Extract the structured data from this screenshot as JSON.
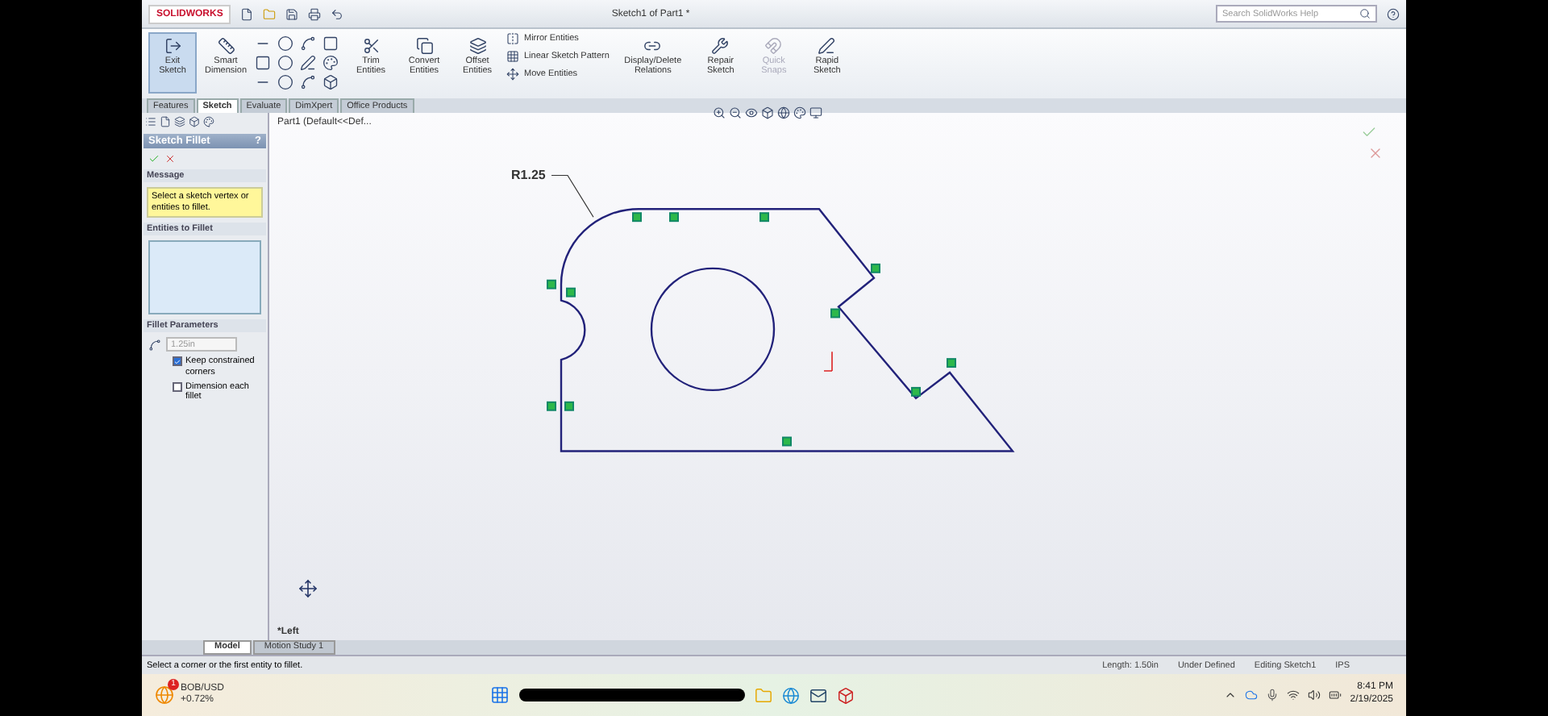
{
  "title_bar": {
    "logo": "SOLIDWORKS",
    "title": "Sketch1 of Part1 *",
    "search": {
      "placeholder": "Search SolidWorks Help"
    }
  },
  "ribbon": {
    "items": [
      {
        "kind": "button",
        "label": "Exit Sketch",
        "selected": true,
        "disabled": false
      },
      {
        "kind": "button",
        "label": "Smart Dimension",
        "selected": false,
        "disabled": false
      },
      {
        "kind": "tools"
      },
      {
        "kind": "button",
        "label": "Trim Entities",
        "selected": false,
        "disabled": false
      },
      {
        "kind": "button",
        "label": "Convert Entities",
        "selected": false,
        "disabled": false
      },
      {
        "kind": "button",
        "label": "Offset Entities",
        "selected": false,
        "disabled": false
      },
      {
        "kind": "list",
        "entries": [
          "Mirror Entities",
          "Linear Sketch Pattern",
          "Move Entities"
        ]
      },
      {
        "kind": "button",
        "label": "Display/Delete Relations",
        "selected": false,
        "disabled": false
      },
      {
        "kind": "button",
        "label": "Repair Sketch",
        "selected": false,
        "disabled": false
      },
      {
        "kind": "button",
        "label": "Quick Snaps",
        "selected": false,
        "disabled": true
      },
      {
        "kind": "button",
        "label": "Rapid Sketch",
        "selected": false,
        "disabled": false
      }
    ]
  },
  "command_tabs": [
    {
      "label": "Features",
      "selected": false
    },
    {
      "label": "Sketch",
      "selected": true
    },
    {
      "label": "Evaluate",
      "selected": false
    },
    {
      "label": "DimXpert",
      "selected": false
    },
    {
      "label": "Office Products",
      "selected": false
    }
  ],
  "property_manager": {
    "title": "Sketch Fillet",
    "help": "?",
    "message": {
      "title": "Message",
      "text": "Select a sketch vertex or entities to fillet."
    },
    "entities": {
      "title": "Entities to Fillet"
    },
    "parameters": {
      "title": "Fillet Parameters",
      "radius": "1.25in",
      "options": [
        {
          "label": "Keep constrained corners",
          "checked": true
        },
        {
          "label": "Dimension each fillet",
          "checked": false
        }
      ]
    }
  },
  "canvas": {
    "breadcrumb": "Part1  (Default<<Def...",
    "dimension": "R1.25",
    "view_label": "*Left"
  },
  "model_tabs": [
    {
      "label": "Model",
      "selected": true
    },
    {
      "label": "Motion Study 1",
      "selected": false
    }
  ],
  "status_bar": {
    "message": "Select a corner or the first entity to fillet.",
    "fields": [
      "Length: 1.50in",
      "Under Defined",
      "Editing Sketch1",
      "IPS"
    ]
  },
  "taskbar": {
    "widget": {
      "ticker": "BOB/USD",
      "change": "+0.72%",
      "badge": "1"
    },
    "clock": {
      "time": "8:41 PM",
      "date": "2/19/2025"
    }
  }
}
